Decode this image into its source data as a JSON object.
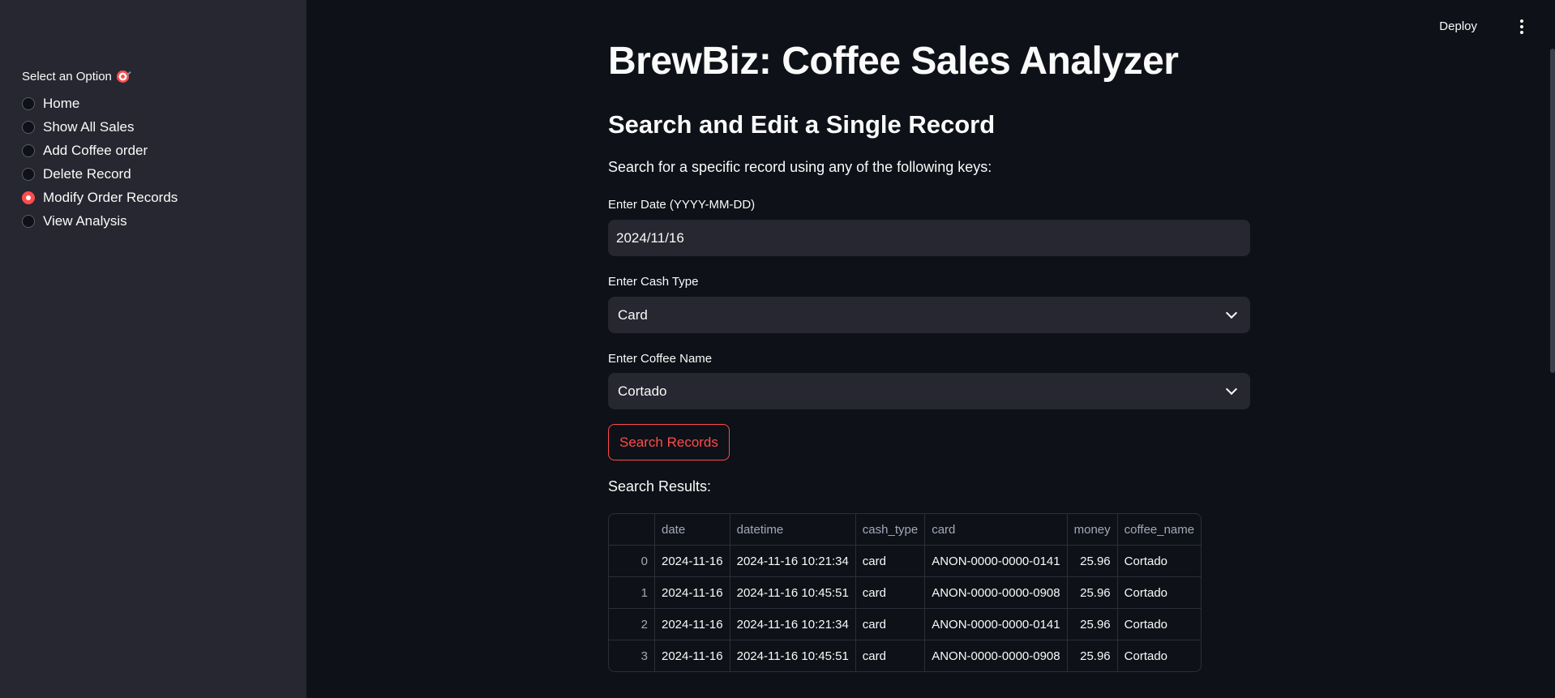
{
  "sidebar": {
    "label": "Select an Option",
    "label_icon": "target-icon",
    "options": [
      {
        "label": "Home",
        "selected": false
      },
      {
        "label": "Show All Sales",
        "selected": false
      },
      {
        "label": "Add Coffee order",
        "selected": false
      },
      {
        "label": "Delete Record",
        "selected": false
      },
      {
        "label": "Modify Order Records",
        "selected": true
      },
      {
        "label": "View Analysis",
        "selected": false
      }
    ]
  },
  "header": {
    "deploy_label": "Deploy",
    "menu_icon": "kebab-menu-icon"
  },
  "main": {
    "title": "BrewBiz: Coffee Sales Analyzer",
    "subtitle": "Search and Edit a Single Record",
    "description": "Search for a specific record using any of the following keys:",
    "date_field": {
      "label": "Enter Date (YYYY-MM-DD)",
      "value": "2024/11/16"
    },
    "cash_type_field": {
      "label": "Enter Cash Type",
      "value": "Card"
    },
    "coffee_name_field": {
      "label": "Enter Coffee Name",
      "value": "Cortado"
    },
    "search_button": "Search Records",
    "results_label": "Search Results:",
    "table": {
      "columns": [
        "",
        "date",
        "datetime",
        "cash_type",
        "card",
        "money",
        "coffee_name"
      ],
      "rows": [
        [
          "0",
          "2024-11-16",
          "2024-11-16 10:21:34",
          "card",
          "ANON-0000-0000-0141",
          "25.96",
          "Cortado"
        ],
        [
          "1",
          "2024-11-16",
          "2024-11-16 10:45:51",
          "card",
          "ANON-0000-0000-0908",
          "25.96",
          "Cortado"
        ],
        [
          "2",
          "2024-11-16",
          "2024-11-16 10:21:34",
          "card",
          "ANON-0000-0000-0141",
          "25.96",
          "Cortado"
        ],
        [
          "3",
          "2024-11-16",
          "2024-11-16 10:45:51",
          "card",
          "ANON-0000-0000-0908",
          "25.96",
          "Cortado"
        ]
      ]
    }
  },
  "colors": {
    "accent": "#ff4b4b",
    "background": "#0e1117",
    "sidebar": "#262730"
  }
}
